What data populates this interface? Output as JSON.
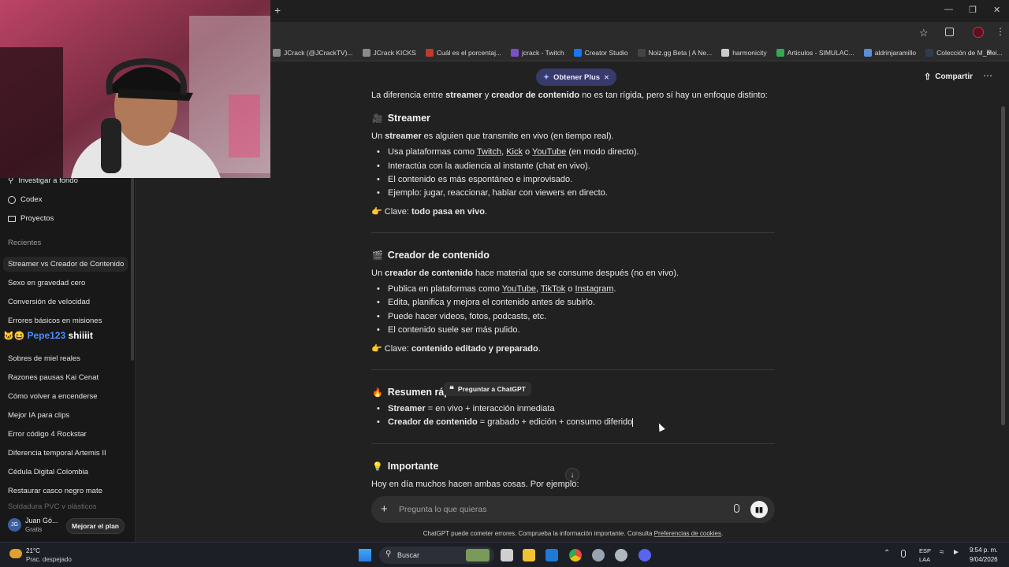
{
  "bookmarks": [
    {
      "label": "JCrack (@JCrackTV)...",
      "color": "#888888"
    },
    {
      "label": "JCrack KICKS",
      "color": "#8a8a8a"
    },
    {
      "label": "Cuál es el porcentaj...",
      "color": "#c0392b"
    },
    {
      "label": "jcrack - Twitch",
      "color": "#7b4fc9"
    },
    {
      "label": "Creator Studio",
      "color": "#1877f2"
    },
    {
      "label": "Noiz.gg Beta | A Ne...",
      "color": "#444444"
    },
    {
      "label": "harmonicity",
      "color": "#cccccc"
    },
    {
      "label": "Articulos - SIMULAC...",
      "color": "#34a853"
    },
    {
      "label": "aldrinjaramillo",
      "color": "#5b8dd6"
    },
    {
      "label": "Colección de M_blei...",
      "color": "#2f3b4f"
    }
  ],
  "header": {
    "plus_label": "Obtener Plus",
    "share_label": "Compartir"
  },
  "sidebar": {
    "items": [
      {
        "label": "Investigar a fondo",
        "icon": "telescope-icon"
      },
      {
        "label": "Codex",
        "icon": "codex-icon"
      },
      {
        "label": "Proyectos",
        "icon": "folder-icon"
      }
    ],
    "recents_heading": "Recientes",
    "recents": [
      "Streamer vs Creador de Contenido",
      "Sexo en gravedad cero",
      "Conversión de velocidad",
      "Errores básicos en misiones",
      "Sobres de miel reales",
      "Razones pausas Kai Cenat",
      "Cómo volver a encenderse",
      "Mejor IA para clips",
      "Error código 4 Rockstar",
      "Diferencia temporal Artemis II",
      "Cédula Digital Colombia",
      "Restaurar casco negro mate",
      "Soldadura PVC y plásticos"
    ],
    "user": {
      "initials": "JG",
      "name": "Juan Gó...",
      "plan": "Gratis",
      "upgrade_label": "Mejorar el plan"
    },
    "overlay_text": "shiiiit"
  },
  "content": {
    "intro": [
      "La diferencia entre ",
      "streamer",
      " y ",
      "creador de contenido",
      " no es tan rígida, pero sí hay un enfoque distinto:"
    ],
    "s1": {
      "title": "Streamer",
      "emoji": "🎥",
      "lead": [
        "Un ",
        "streamer",
        " es alguien que transmite en vivo (en tiempo real)."
      ],
      "b1": [
        "Usa plataformas como ",
        "Twitch",
        ", ",
        "Kick",
        " o ",
        "YouTube",
        " (en modo directo)."
      ],
      "b2": "Interactúa con la audiencia al instante (chat en vivo).",
      "b3": "El contenido es más espontáneo e improvisado.",
      "b4": "Ejemplo: jugar, reaccionar, hablar con viewers en directo.",
      "key": [
        "👉 Clave: ",
        "todo pasa en vivo",
        "."
      ]
    },
    "s2": {
      "title": "Creador de contenido",
      "emoji": "🎬",
      "lead": [
        "Un ",
        "creador de contenido",
        " hace material que se consume después (no en vivo)."
      ],
      "b1": [
        "Publica en plataformas como ",
        "YouTube",
        ", ",
        "TikTok",
        " o ",
        "Instagram",
        "."
      ],
      "b2": "Edita, planifica y mejora el contenido antes de subirlo.",
      "b3": "Puede hacer videos, fotos, podcasts, etc.",
      "b4": "El contenido suele ser más pulido.",
      "key": [
        "👉 Clave: ",
        "contenido editado y preparado",
        "."
      ]
    },
    "s3": {
      "title": "Resumen ráp",
      "emoji": "🔥",
      "tooltip": "Preguntar a ChatGPT",
      "b1": [
        "Streamer",
        " = en vivo + interacción inmediata"
      ],
      "b2": [
        "Creador de contenido",
        " = grabado + edición + consumo diferido"
      ]
    },
    "s4": {
      "title": "Importante",
      "emoji": "💡",
      "lead": "Hoy en día muchos hacen ambas cosas. Por ejemplo:"
    }
  },
  "composer": {
    "placeholder": "Pregunta lo que quieras",
    "disclaimer": "ChatGPT puede cometer errores. Comprueba la información importante. Consulta ",
    "disclaimer_link": "Preferencias de cookies",
    "disclaimer_end": "."
  },
  "taskbar": {
    "weather_temp": "21°C",
    "weather_desc": "Prac. despejado",
    "search_label": "Buscar",
    "lang1": "ESP",
    "lang2": "LAA",
    "time": "9:54 p. m.",
    "date": "9/04/2026"
  }
}
